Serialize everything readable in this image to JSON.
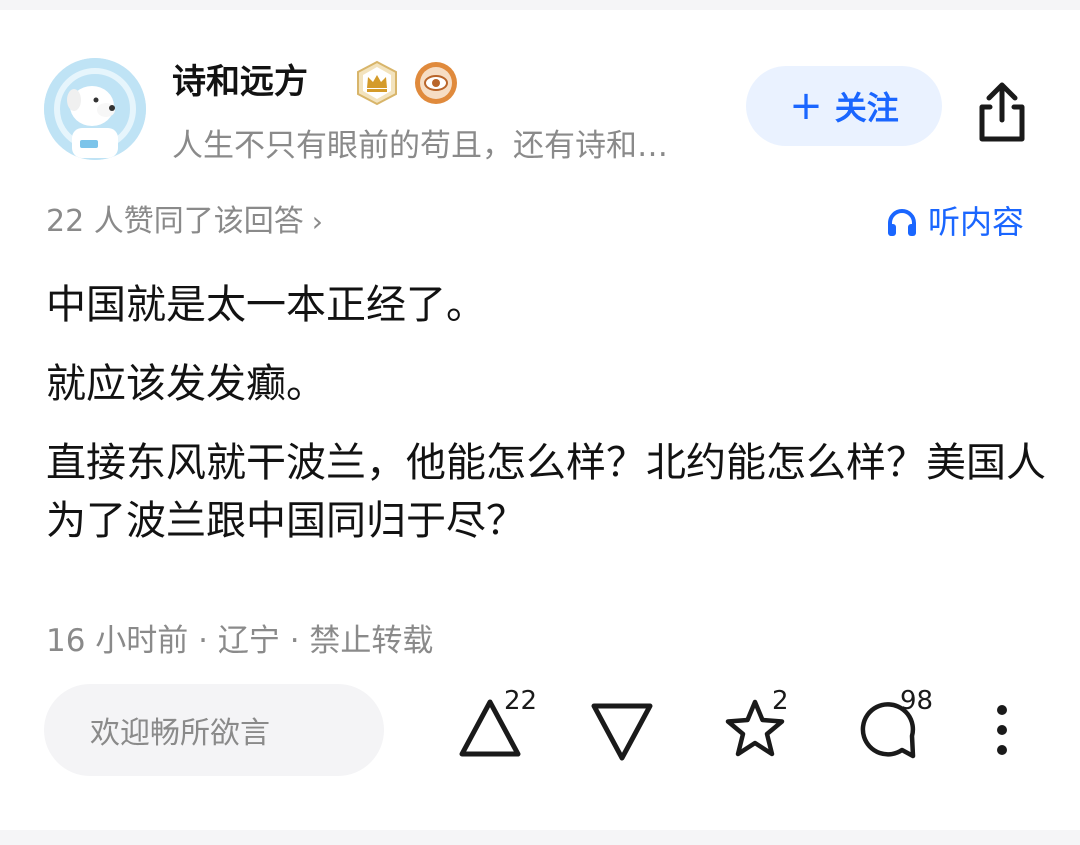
{
  "author": {
    "name": "诗和远方",
    "bio": "人生不只有眼前的苟且，还有诗和…",
    "badges": [
      "crown-badge-icon",
      "eye-badge-icon"
    ]
  },
  "header": {
    "follow_label": "关注",
    "follow_icon": "plus-icon",
    "share_icon": "share-icon"
  },
  "meta": {
    "upvote_summary": "22 人赞同了该回答",
    "listen_label": "听内容",
    "listen_icon": "headphones-icon"
  },
  "answer": {
    "paragraphs": [
      "中国就是太一本正经了。",
      "就应该发发癫。",
      "直接东风就干波兰，他能怎么样？北约能怎么样？美国人为了波兰跟中国同归于尽？"
    ],
    "timestamp": "16 小时前 · 辽宁 · 禁止转载"
  },
  "actions": {
    "comment_placeholder": "欢迎畅所欲言",
    "upvote_count": "22",
    "favorite_count": "2",
    "comment_count": "98"
  },
  "colors": {
    "accent": "#1a66ff",
    "follow_bg": "#eaf2ff",
    "muted_text": "#8a8a8a"
  }
}
